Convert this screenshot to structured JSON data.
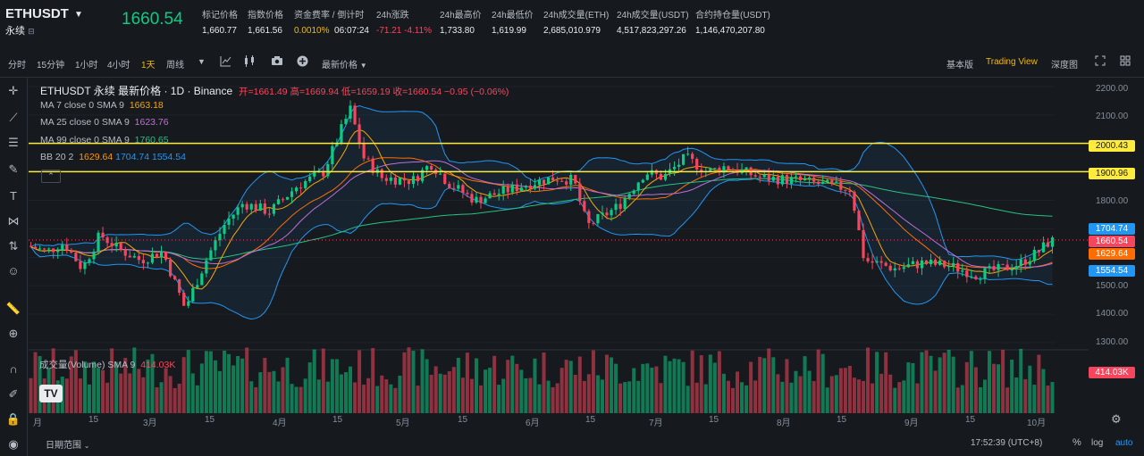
{
  "header": {
    "symbol": "ETHUSDT",
    "contract_type": "永续",
    "last_price": "1660.54",
    "stats": [
      {
        "label": "标记价格",
        "value": "1,660.77"
      },
      {
        "label": "指数价格",
        "value": "1,661.56"
      },
      {
        "label": "资金费率 / 倒计时",
        "value": "0.0010%",
        "value2": "06:07:24"
      },
      {
        "label": "24h涨跌",
        "value": "-71.21 -4.11%"
      },
      {
        "label": "24h最高价",
        "value": "1,733.80"
      },
      {
        "label": "24h最低价",
        "value": "1,619.99"
      },
      {
        "label": "24h成交量(ETH)",
        "value": "2,685,010.979"
      },
      {
        "label": "24h成交量(USDT)",
        "value": "4,517,823,297.26"
      },
      {
        "label": "合约持仓量(USDT)",
        "value": "1,146,470,207.80"
      }
    ]
  },
  "toolbar": {
    "intervals": [
      "分时",
      "15分钟",
      "1小时",
      "4小时",
      "1天",
      "周线"
    ],
    "active_interval": "1天",
    "price_type": "最新价格",
    "views": [
      "基本版",
      "Trading View",
      "深度图"
    ],
    "active_view": "Trading View"
  },
  "legend": {
    "title": "ETHUSDT 永续 最新价格 · 1D · Binance",
    "ohlc": "开=1661.49 高=1669.94 低=1659.19 收=1660.54 −0.95 (−0.06%)",
    "ma7_label": "MA 7 close 0 SMA 9",
    "ma7_value": "1663.18",
    "ma25_label": "MA 25 close 0 SMA 9",
    "ma25_value": "1623.76",
    "ma99_label": "MA 99 close 0 SMA 9",
    "ma99_value": "1760.65",
    "bb_label": "BB 20 2",
    "bb_mid": "1629.64",
    "bb_upper": "1704.74",
    "bb_lower": "1554.54",
    "volume_label": "成交量(Volume) SMA 9",
    "volume_value": "414.03K"
  },
  "price_tags": {
    "line1": "2000.43",
    "line2": "1900.96",
    "upper": "1704.74",
    "last": "1660.54",
    "mid": "1629.64",
    "lower": "1554.54",
    "volume": "414.03K"
  },
  "y_axis": [
    "2200.00",
    "2100.00",
    "2000.00",
    "1900.00",
    "1800.00",
    "1700.00",
    "1600.00",
    "1500.00",
    "1400.00",
    "1300.00"
  ],
  "x_axis": [
    "月",
    "15",
    "3月",
    "15",
    "4月",
    "15",
    "5月",
    "15",
    "6月",
    "15",
    "7月",
    "15",
    "8月",
    "15",
    "9月",
    "15",
    "10月"
  ],
  "footer": {
    "range_label": "日期范围",
    "clock": "17:52:39 (UTC+8)",
    "percent": "%",
    "log": "log",
    "auto": "auto"
  },
  "colors": {
    "up": "#0ecb81",
    "down": "#f6465d",
    "accent": "#f0b90b",
    "ma7": "#f7a600",
    "ma25": "#c06fd6",
    "ma99": "#26c281",
    "bb": "#2196f3"
  }
}
